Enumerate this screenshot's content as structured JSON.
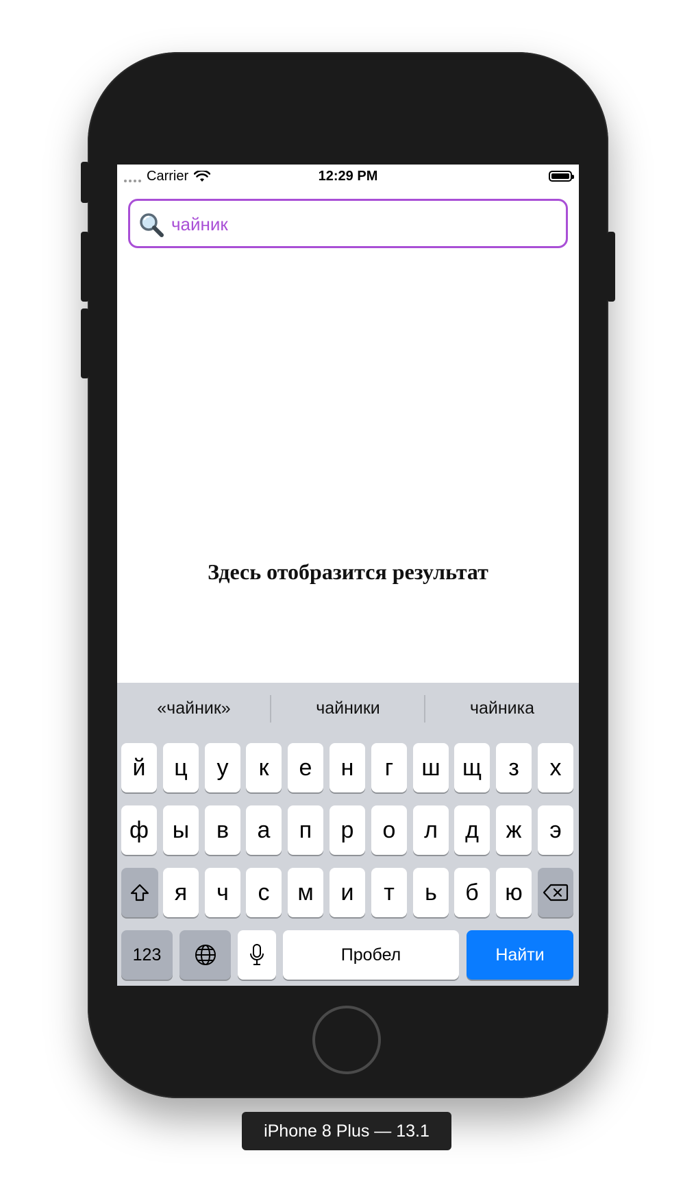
{
  "device": {
    "label": "iPhone 8 Plus — 13.1"
  },
  "statusbar": {
    "carrier": "Carrier",
    "time": "12:29 PM"
  },
  "search": {
    "value": "чайник",
    "accent": "#a94fd6"
  },
  "result": {
    "text": "Здесь отобразится результат"
  },
  "keyboard": {
    "suggestions": [
      "«чайник»",
      "чайники",
      "чайника"
    ],
    "row1": [
      "й",
      "ц",
      "у",
      "к",
      "е",
      "н",
      "г",
      "ш",
      "щ",
      "з",
      "х"
    ],
    "row2": [
      "ф",
      "ы",
      "в",
      "а",
      "п",
      "р",
      "о",
      "л",
      "д",
      "ж",
      "э"
    ],
    "row3": [
      "я",
      "ч",
      "с",
      "м",
      "и",
      "т",
      "ь",
      "б",
      "ю"
    ],
    "numbers_label": "123",
    "space_label": "Пробел",
    "go_label": "Найти",
    "go_color": "#0a7cff"
  }
}
